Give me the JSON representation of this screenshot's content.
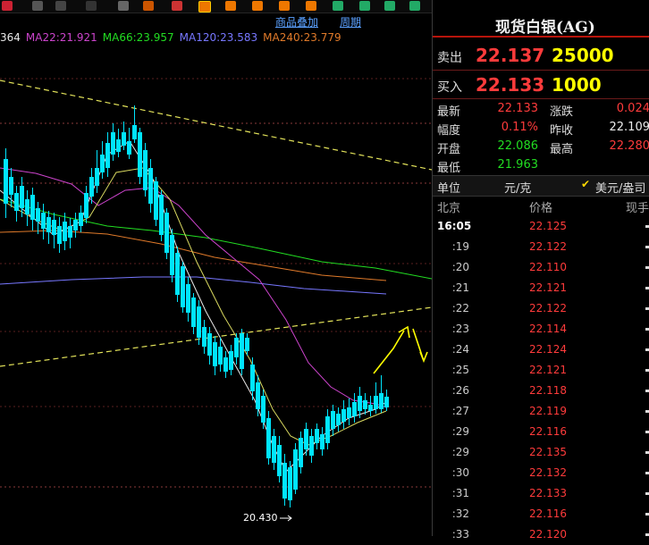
{
  "subbar": {
    "overlay_link": "商品叠加",
    "period_link": "周期"
  },
  "ma_legend": [
    {
      "label": "364",
      "color": "#e8e8e8"
    },
    {
      "label": "MA22:21.921",
      "color": "#cc44cc"
    },
    {
      "label": "MA66:23.957",
      "color": "#22dd22"
    },
    {
      "label": "MA120:23.583",
      "color": "#7777ff"
    },
    {
      "label": "MA240:23.779",
      "color": "#e07a2a"
    }
  ],
  "chart": {
    "low_label": "20.430",
    "colors": {
      "up": "#ff3b3b",
      "down": "#00e5ff",
      "trend": "#e3e35a"
    }
  },
  "panel": {
    "title": "现货白银(AG)",
    "sell": {
      "label": "卖出",
      "price": "22.137",
      "volume": "25000"
    },
    "buy": {
      "label": "买入",
      "price": "22.133",
      "volume": "1000"
    },
    "stats": {
      "latest": {
        "label": "最新",
        "value": "22.133"
      },
      "change": {
        "label": "涨跌",
        "value": "0.024"
      },
      "amplitude": {
        "label": "幅度",
        "value": "0.11%"
      },
      "prev_close": {
        "label": "昨收",
        "value": "22.109"
      },
      "open": {
        "label": "开盘",
        "value": "22.086"
      },
      "high": {
        "label": "最高",
        "value": "22.280"
      },
      "low": {
        "label": "最低",
        "value": "21.963"
      }
    },
    "unit": {
      "label": "单位",
      "value": "元/克",
      "alt": "美元/盎司"
    },
    "tick_header": {
      "time": "北京",
      "price": "价格",
      "volume": "现手"
    },
    "ticks": [
      {
        "time": "16:05",
        "price": "22.125"
      },
      {
        "time": ":19",
        "price": "22.122"
      },
      {
        "time": ":20",
        "price": "22.110"
      },
      {
        "time": ":21",
        "price": "22.121"
      },
      {
        "time": ":22",
        "price": "22.122"
      },
      {
        "time": ":23",
        "price": "22.114"
      },
      {
        "time": ":24",
        "price": "22.124"
      },
      {
        "time": ":25",
        "price": "22.121"
      },
      {
        "time": ":26",
        "price": "22.118"
      },
      {
        "time": ":27",
        "price": "22.119"
      },
      {
        "time": ":29",
        "price": "22.116"
      },
      {
        "time": ":29",
        "price": "22.135"
      },
      {
        "time": ":30",
        "price": "22.132"
      },
      {
        "time": ":31",
        "price": "22.133"
      },
      {
        "time": ":32",
        "price": "22.116"
      },
      {
        "time": ":33",
        "price": "22.120"
      }
    ]
  }
}
